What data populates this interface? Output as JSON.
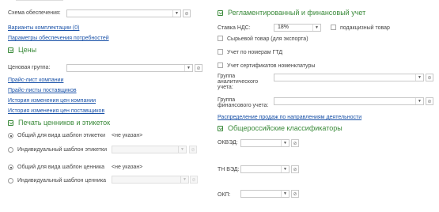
{
  "left": {
    "schema_label": "Схема обеспечения:",
    "links_top": [
      "Варианты комплектации (0)",
      "Параметры обеспечения потребностей"
    ],
    "prices_header": "Цены",
    "price_group_label": "Ценовая группа:",
    "price_links": [
      "Прайс-лист компании",
      "Прайс-листы поставщиков",
      "История изменения цен компании",
      "История изменения цен поставщиков"
    ],
    "print_header": "Печать ценников и этикеток",
    "label_common": "Общий для вида шаблон этикетки",
    "label_common_value": "<не указан>",
    "label_individual": "Индивидуальный шаблон этикетки",
    "tag_common": "Общий для вида шаблон ценника",
    "tag_common_value": "<не указан>",
    "tag_individual": "Индивидуальный шаблон ценника"
  },
  "right": {
    "reg_header": "Регламентированный и финансовый учет",
    "vat_label": "Ставка НДС:",
    "vat_value": "18%",
    "excise_label": "подакцизный товар",
    "raw_label": "Сырьевой товар (для экспорта)",
    "gtd_label": "Учет по номерам ГТД",
    "cert_label": "Учет сертификатов номенклатуры",
    "analytic_label": "Группа аналитического учета:",
    "finance_label": "Группа финансового учета:",
    "distribution_link": "Распределение продаж по направлениям деятельности",
    "classifiers_header": "Общероссийские классификаторы",
    "okved_label": "ОКВЭД:",
    "tnved_label": "ТН ВЭД:",
    "okp_label": "ОКП:"
  },
  "icons": {
    "dropdown": "chevron-down-icon",
    "open": "link-icon",
    "toggle": "chevron-collapse-icon"
  },
  "colors": {
    "section_header": "#3a8a3a",
    "link": "#1a52a8"
  }
}
